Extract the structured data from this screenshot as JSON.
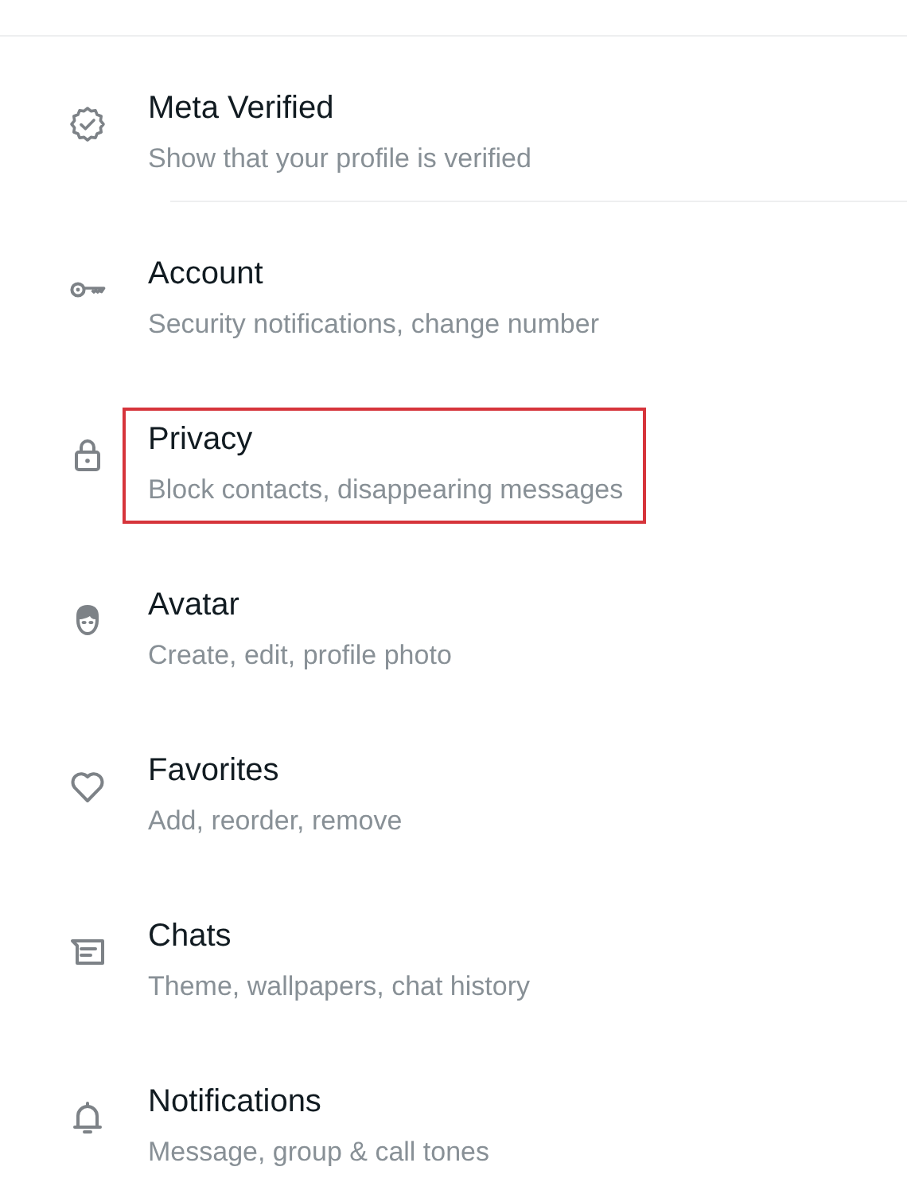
{
  "settings": [
    {
      "title": "Meta Verified",
      "subtitle": "Show that your profile is verified",
      "highlighted": false,
      "divider": true
    },
    {
      "title": "Account",
      "subtitle": "Security notifications, change number",
      "highlighted": false,
      "divider": false
    },
    {
      "title": "Privacy",
      "subtitle": "Block contacts, disappearing messages",
      "highlighted": true,
      "divider": false
    },
    {
      "title": "Avatar",
      "subtitle": "Create, edit, profile photo",
      "highlighted": false,
      "divider": false
    },
    {
      "title": "Favorites",
      "subtitle": "Add, reorder, remove",
      "highlighted": false,
      "divider": false
    },
    {
      "title": "Chats",
      "subtitle": "Theme, wallpapers, chat history",
      "highlighted": false,
      "divider": false
    },
    {
      "title": "Notifications",
      "subtitle": "Message, group & call tones",
      "highlighted": false,
      "divider": false
    }
  ]
}
